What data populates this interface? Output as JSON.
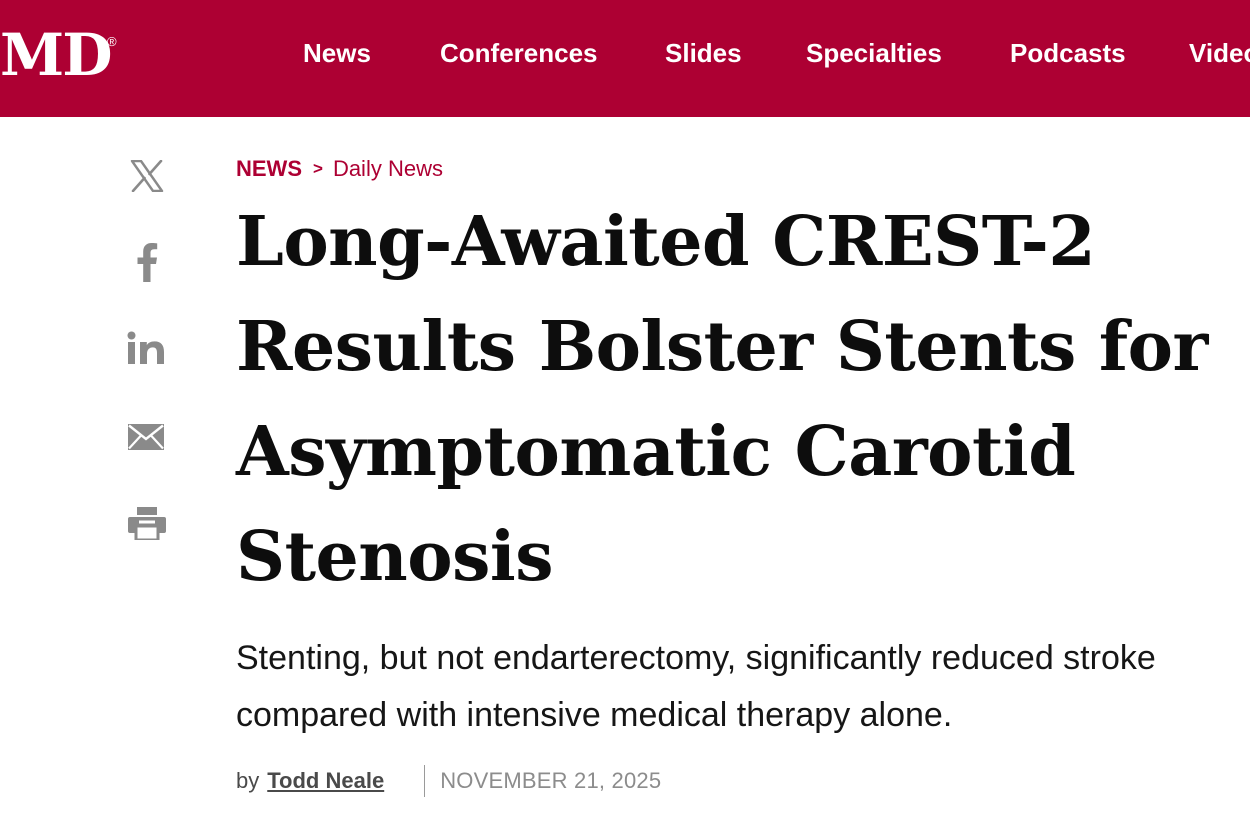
{
  "header": {
    "logo_text": "MD",
    "logo_mark": "®",
    "nav": [
      "News",
      "Conferences",
      "Slides",
      "Specialties",
      "Podcasts",
      "Video"
    ],
    "brand_color": "#ad0033"
  },
  "share": {
    "icons": [
      "x-icon",
      "facebook-icon",
      "linkedin-icon",
      "email-icon",
      "print-icon"
    ]
  },
  "breadcrumb": {
    "section": "NEWS",
    "separator": ">",
    "subsection": "Daily News"
  },
  "article": {
    "headline": "Long-Awaited CREST-2 Results Bolster Stents for Asymptomatic Carotid Stenosis",
    "deck_line1": "Stenting, but not endarterectomy, significantly reduced stroke",
    "deck_line2": "compared with intensive medical therapy alone.",
    "by_prefix": "by",
    "author": "Todd Neale",
    "date": "NOVEMBER 21, 2025"
  }
}
